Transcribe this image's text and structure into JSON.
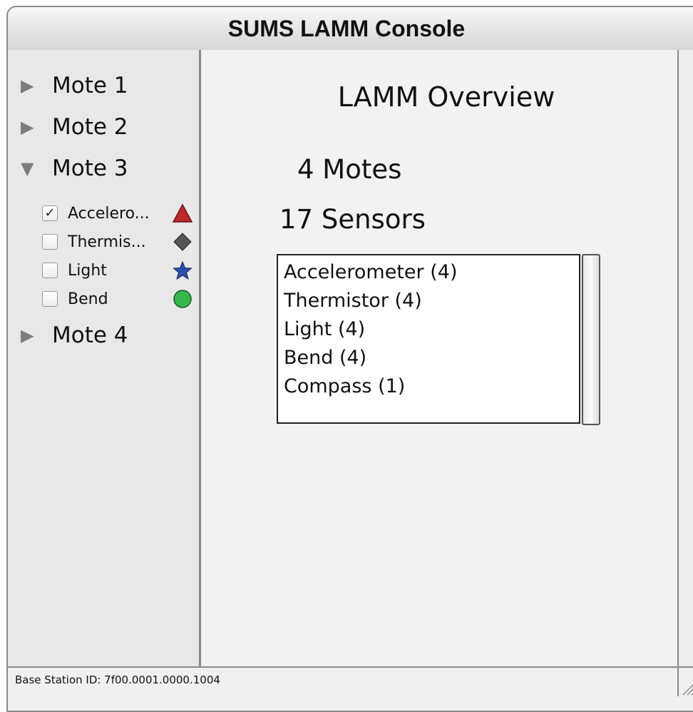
{
  "window": {
    "title": "SUMS LAMM Console"
  },
  "sidebar": {
    "motes": [
      {
        "label": "Mote 1",
        "expanded": false
      },
      {
        "label": "Mote 2",
        "expanded": false
      },
      {
        "label": "Mote 3",
        "expanded": true,
        "sensors": [
          {
            "label": "Accelero...",
            "checked": true,
            "marker": "triangle-icon",
            "color": "#c0282b"
          },
          {
            "label": "Thermis...",
            "checked": false,
            "marker": "diamond-icon",
            "color": "#555555"
          },
          {
            "label": "Light",
            "checked": false,
            "marker": "star-icon",
            "color": "#2b4fae"
          },
          {
            "label": "Bend",
            "checked": false,
            "marker": "circle-icon",
            "color": "#35b84a"
          }
        ]
      },
      {
        "label": "Mote 4",
        "expanded": false
      }
    ]
  },
  "main": {
    "title": "LAMM Overview",
    "motes_count": "4 Motes",
    "sensors_count": "17 Sensors",
    "sensor_list": [
      "Accelerometer (4)",
      "Thermistor (4)",
      "Light (4)",
      "Bend (4)",
      "Compass (1)"
    ]
  },
  "status": {
    "text": "Base Station ID: 7f00.0001.0000.1004"
  },
  "colors": {
    "checkmark": "☑"
  }
}
